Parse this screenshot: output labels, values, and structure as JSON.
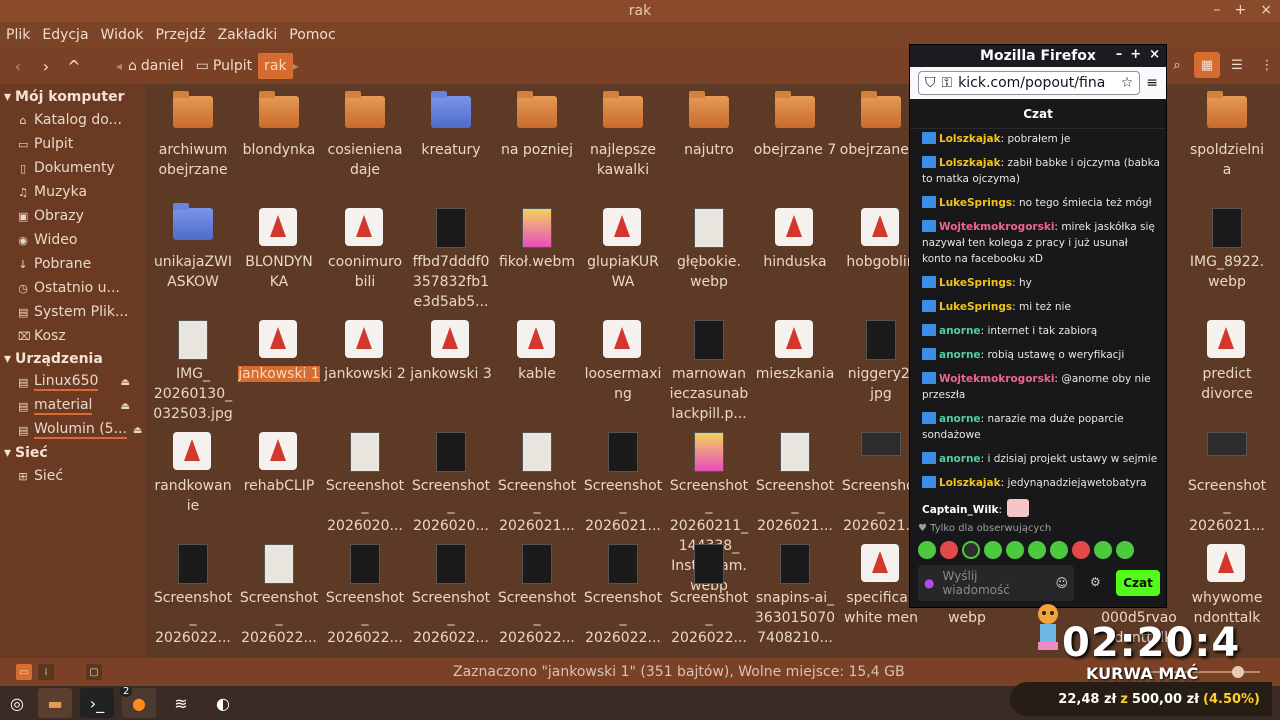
{
  "window": {
    "title": "rak",
    "controls": [
      "–",
      "+",
      "×"
    ]
  },
  "menu": [
    "Plik",
    "Edycja",
    "Widok",
    "Przejdź",
    "Zakładki",
    "Pomoc"
  ],
  "breadcrumbs": [
    "daniel",
    "Pulpit",
    "rak"
  ],
  "sidebar": {
    "sections": [
      {
        "title": "Mój komputer",
        "items": [
          {
            "label": "Katalog do...",
            "icon": "home-icon"
          },
          {
            "label": "Pulpit",
            "icon": "folder-icon"
          },
          {
            "label": "Dokumenty",
            "icon": "folder-icon"
          },
          {
            "label": "Muzyka",
            "icon": "music-icon"
          },
          {
            "label": "Obrazy",
            "icon": "image-icon"
          },
          {
            "label": "Wideo",
            "icon": "video-icon"
          },
          {
            "label": "Pobrane",
            "icon": "download-icon"
          },
          {
            "label": "Ostatnio u...",
            "icon": "clock-icon"
          },
          {
            "label": "System Plik...",
            "icon": "drive-icon"
          },
          {
            "label": "Kosz",
            "icon": "trash-icon"
          }
        ]
      },
      {
        "title": "Urządzenia",
        "items": [
          {
            "label": "Linux650",
            "icon": "drive-icon"
          },
          {
            "label": "material",
            "icon": "drive-icon"
          },
          {
            "label": "Wolumin (5...",
            "icon": "drive-icon"
          }
        ]
      },
      {
        "title": "Sieć",
        "items": [
          {
            "label": "Sieć",
            "icon": "network-icon"
          }
        ]
      }
    ]
  },
  "files": [
    [
      "archiwum obejrzane",
      "blondynka",
      "cosieniena daje",
      "kreatury",
      "na pozniej",
      "najlepsze kawalki",
      "najutro",
      "obejrzane 7",
      "obejrzane 8",
      "",
      "",
      "",
      "spoldzielni a"
    ],
    [
      "unikajaZWI ASKOW",
      "BLONDYN KA",
      "coonimuro bili",
      "ffbd7dddf0 357832fb1 e3d5ab5...",
      "fikoł.webm",
      "glupiaKUR WA",
      "głębokie. webp",
      "hinduska",
      "hobgoblin",
      "",
      "",
      "",
      "IMG_8922. webp"
    ],
    [
      "IMG_ 20260130_ 032503.jpg",
      "jankowski 1",
      "jankowski 2",
      "jankowski 3",
      "kable",
      "loosermaxi ng",
      "marnowan ieczasunab lackpill.p...",
      "mieszkania",
      "niggery2. jpg",
      "",
      "",
      "",
      "predict divorce"
    ],
    [
      "randkowan ie",
      "rehabCLIP",
      "Screenshot _ 2026020...",
      "Screenshot _ 2026020...",
      "Screenshot _ 2026021...",
      "Screenshot _ 2026021...",
      "Screenshot _ 20260211_ 144338_ Instagram. webp",
      "Screenshot _ 2026021...",
      "Screenshot _ 2026021...",
      "",
      "",
      "",
      "Screenshot _ 2026021..."
    ],
    [
      "Screenshot _ 2026022...",
      "Screenshot _ 2026022...",
      "Screenshot _ 2026022...",
      "Screenshot _ 2026022...",
      "Screenshot _ 2026022...",
      "Screenshot _ 2026022...",
      "Screenshot _ 2026022...",
      "snapins-ai_ 363015070 7408210...",
      "specificall white men",
      "jebany. webp",
      "",
      "0 000d5rvao ndonttalk",
      "whywome ndonttalk"
    ]
  ],
  "status": {
    "text": "Zaznaczono \"jankowski 1\" (351 bajtów), Wolne miejsce: 15,4 GB"
  },
  "taskbar": {
    "firefox_badge": "2"
  },
  "overlay": {
    "timer": "02:20:4",
    "caption": "KURWA MAĆ",
    "money_current": "22,48 zł",
    "money_of": "z",
    "money_goal": "500,00 zł",
    "money_pct": "(4.50%)"
  },
  "firefox": {
    "title": "Mozilla Firefox",
    "url": "kick.com/popout/fina",
    "chat_title": "Czat",
    "messages": [
      {
        "user": "Lolszkajak",
        "color": "#f0c419",
        "text": "pobrałem je"
      },
      {
        "user": "Lolszkajak",
        "color": "#f0c419",
        "text": "zabił babke i ojczyma (babka to matka ojczyma)"
      },
      {
        "user": "LukeSprings",
        "color": "#f0c419",
        "text": "no tego śmiecia też mógł"
      },
      {
        "user": "Wojtekmokrogorski",
        "color": "#f06292",
        "text": "mirek jaskółka się nazywał ten kolega z pracy i już usunał konto na facebooku xD"
      },
      {
        "user": "LukeSprings",
        "color": "#f0c419",
        "text": "hy"
      },
      {
        "user": "LukeSprings",
        "color": "#f0c419",
        "text": "mi też nie"
      },
      {
        "user": "anorne",
        "color": "#4dd0a0",
        "text": "internet i tak zabiorą"
      },
      {
        "user": "anorne",
        "color": "#4dd0a0",
        "text": "robią ustawę o weryfikacji"
      },
      {
        "user": "Wojtekmokrogorski",
        "color": "#f06292",
        "text": "@anorne oby nie przeszła"
      },
      {
        "user": "anorne",
        "color": "#4dd0a0",
        "text": "narazie ma duże poparcie sondażowe"
      },
      {
        "user": "anorne",
        "color": "#4dd0a0",
        "text": "i dzisiaj projekt ustawy w sejmie"
      },
      {
        "user": "Lolszkajak",
        "color": "#f0c419",
        "text": "jedynąnadziejąwetobatyra"
      },
      {
        "user": "Captain_Wilk",
        "color": "#ffffff",
        "text": ""
      }
    ],
    "followers_only": "Tylko dla obserwujących",
    "input_placeholder": "Wyślij wiadomość",
    "send_label": "Czat"
  }
}
